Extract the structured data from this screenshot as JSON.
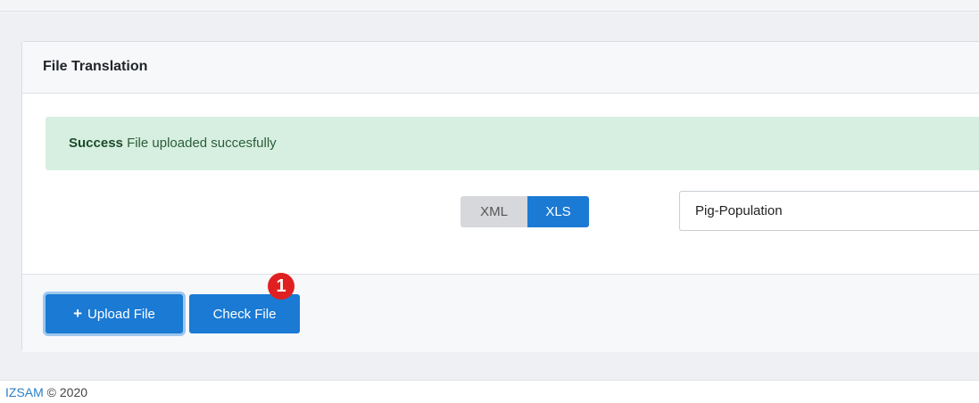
{
  "card": {
    "title": "File Translation"
  },
  "alert": {
    "strong": "Success",
    "message": "File uploaded succesfully"
  },
  "format_toggle": {
    "options": [
      "XML",
      "XLS"
    ],
    "selected": "XLS"
  },
  "name_input": {
    "value": "Pig-Population"
  },
  "actions": {
    "upload_label": "Upload File",
    "check_label": "Check File"
  },
  "annotation": {
    "badge": "1"
  },
  "footer": {
    "link": "IZSAM",
    "copyright": "© 2020"
  },
  "colors": {
    "primary": "#1a7ad4",
    "success_bg": "#d7efe0",
    "badge": "#e02020"
  },
  "icons": {
    "upload": "plus-icon"
  }
}
